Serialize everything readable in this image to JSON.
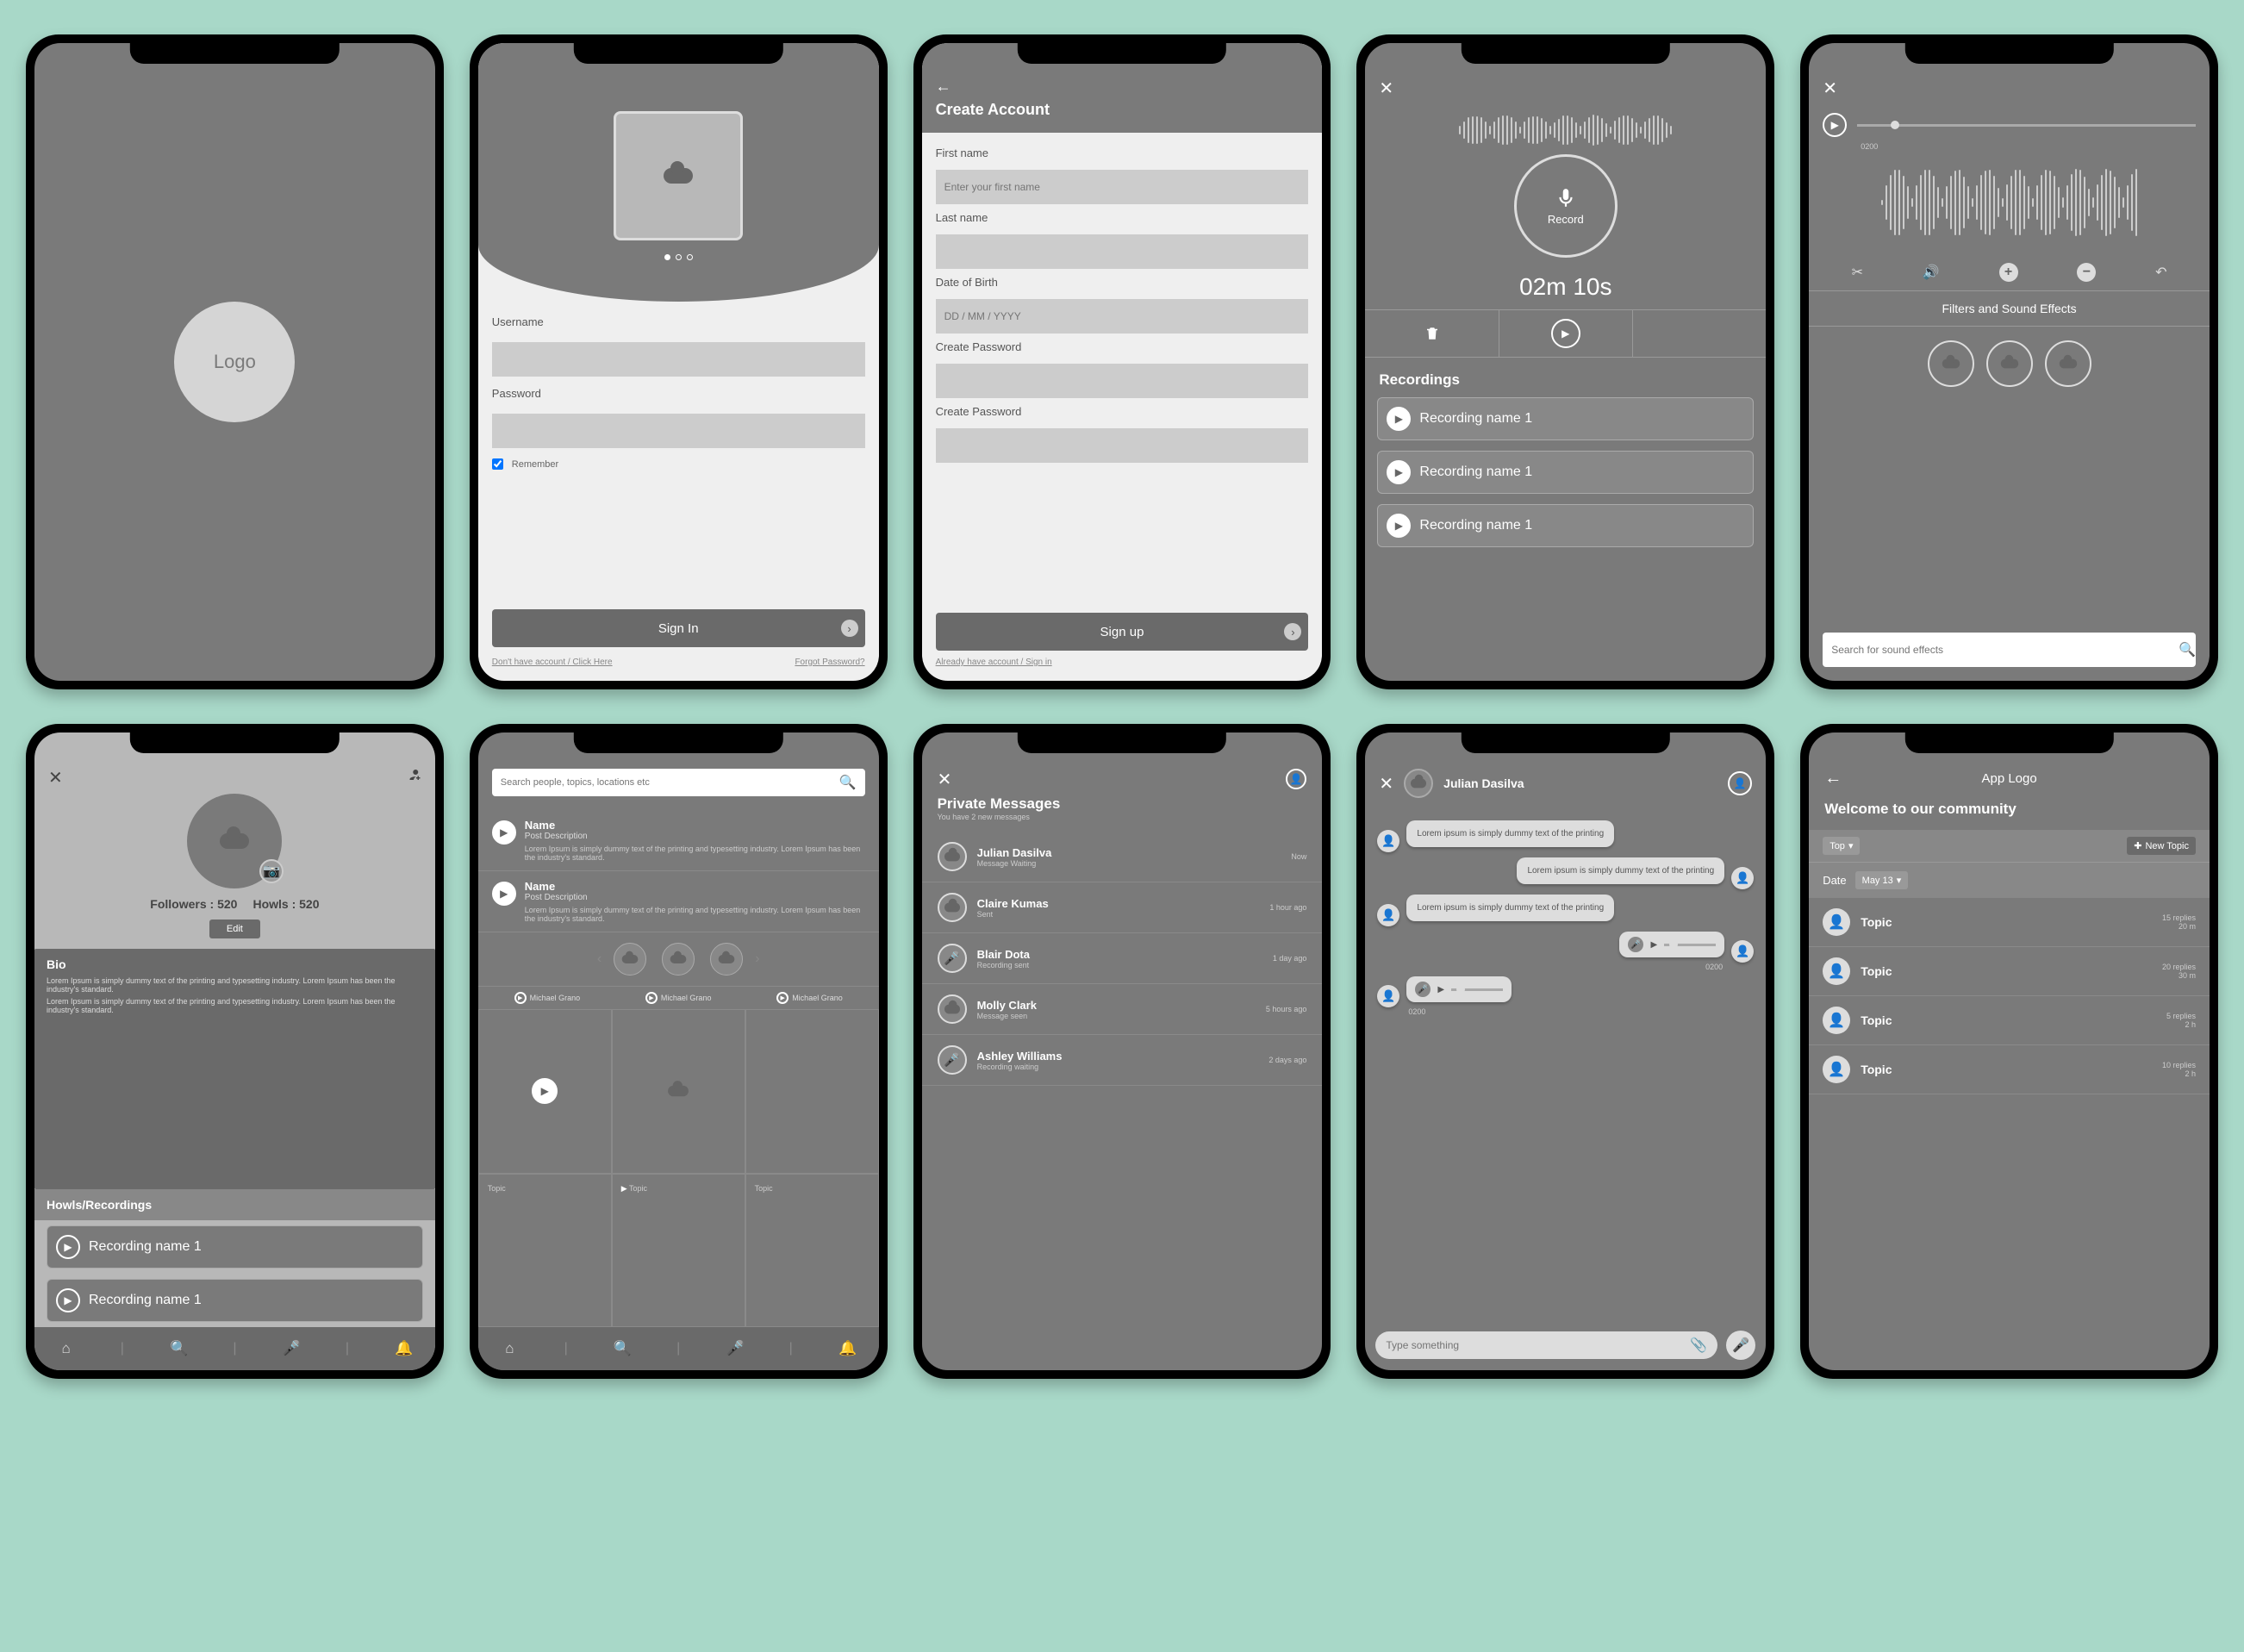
{
  "s1": {
    "logo": "Logo"
  },
  "s2": {
    "user_label": "Username",
    "pass_label": "Password",
    "remember": "Remember",
    "signin": "Sign In",
    "no_account": "Don't have account / Click Here",
    "forgot": "Forgot Password?"
  },
  "s3": {
    "title": "Create Account",
    "fn": "First name",
    "fn_ph": "Enter your first name",
    "ln": "Last name",
    "dob": "Date of Birth",
    "dob_ph": "DD / MM / YYYY",
    "cp": "Create Password",
    "cp2": "Create Password",
    "signup": "Sign up",
    "have": "Already have account / Sign in"
  },
  "s4": {
    "record": "Record",
    "time": "02m 10s",
    "heading": "Recordings",
    "items": [
      "Recording name 1",
      "Recording name 1",
      "Recording name 1"
    ]
  },
  "s5": {
    "time": "0200",
    "filters": "Filters and Sound Effects",
    "search_ph": "Search for sound effects"
  },
  "s6": {
    "followers_l": "Followers :",
    "followers_v": "520",
    "howls_l": "Howls :",
    "howls_v": "520",
    "edit": "Edit",
    "bio": "Bio",
    "bio_text1": "Lorem Ipsum is simply dummy text of the printing and typesetting industry. Lorem Ipsum has been the industry's standard.",
    "bio_text2": "Lorem Ipsum is simply dummy text of the printing and typesetting industry. Lorem Ipsum has been the industry's standard.",
    "hr": "Howls/Recordings",
    "items": [
      "Recording name 1",
      "Recording name 1"
    ]
  },
  "s7": {
    "search_ph": "Search people, topics, locations etc",
    "posts": [
      {
        "name": "Name",
        "sub": "Post Description",
        "body": "Lorem Ipsum is simply dummy text of the printing and typesetting industry. Lorem Ipsum has been the industry's standard."
      },
      {
        "name": "Name",
        "sub": "Post Description",
        "body": "Lorem Ipsum is simply dummy text of the printing and typesetting industry. Lorem Ipsum has been the industry's standard."
      }
    ],
    "users": [
      "Michael Grano",
      "Michael Grano",
      "Michael Grano"
    ],
    "topic": "Topic"
  },
  "s8": {
    "title": "Private Messages",
    "sub": "You have 2 new messages",
    "msgs": [
      {
        "name": "Julian Dasilva",
        "sub": "Message Waiting",
        "time": "Now",
        "icon": "cloud"
      },
      {
        "name": "Claire Kumas",
        "sub": "Sent",
        "time": "1 hour ago",
        "icon": "cloud"
      },
      {
        "name": "Blair Dota",
        "sub": "Recording sent",
        "time": "1 day ago",
        "icon": "mic"
      },
      {
        "name": "Molly Clark",
        "sub": "Message seen",
        "time": "5 hours ago",
        "icon": "cloud"
      },
      {
        "name": "Ashley Williams",
        "sub": "Recording waiting",
        "time": "2 days ago",
        "icon": "mic"
      }
    ]
  },
  "s9": {
    "name": "Julian Dasilva",
    "m1": "Lorem ipsum is simply dummy text of the printing",
    "m2": "Lorem ipsum is simply dummy text of the printing",
    "m3": "Lorem ipsum is simply dummy text of the printing",
    "a1": "0200",
    "a2": "0200",
    "compose_ph": "Type something"
  },
  "s10": {
    "logo": "App Logo",
    "welcome": "Welcome to our community",
    "top": "Top",
    "new": "New Topic",
    "date": "Date",
    "may": "May 13",
    "topics": [
      {
        "t": "Topic",
        "r": "15 replies",
        "m": "20 m"
      },
      {
        "t": "Topic",
        "r": "20 replies",
        "m": "30 m"
      },
      {
        "t": "Topic",
        "r": "5 replies",
        "m": "2 h"
      },
      {
        "t": "Topic",
        "r": "10 replies",
        "m": "2 h"
      }
    ]
  }
}
